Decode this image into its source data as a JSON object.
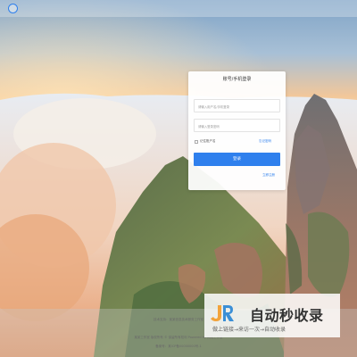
{
  "header": {
    "logo_icon": "circle-logo-icon"
  },
  "login": {
    "title": "账号/手机登录",
    "username_placeholder": "请输入用户名/手机登录",
    "password_placeholder": "请输入登录密码",
    "remember_label": "记住账户名",
    "forgot_label": "忘记密码",
    "login_button": "登录",
    "register_link": "立即注册",
    "accent_color": "#2f80ed"
  },
  "footer": {
    "line1": "技术支持：某某信息技术服务工作室",
    "line2": "某某工作室 版权所有 © 保留所有权利 Powered by 网络工作室",
    "line3": "备案号：某ICP备00000000号-1"
  },
  "watermark": {
    "logo_text": "JR",
    "title": "自动秒收录",
    "subtitle": "做上链接→来访一次→自动收录"
  }
}
